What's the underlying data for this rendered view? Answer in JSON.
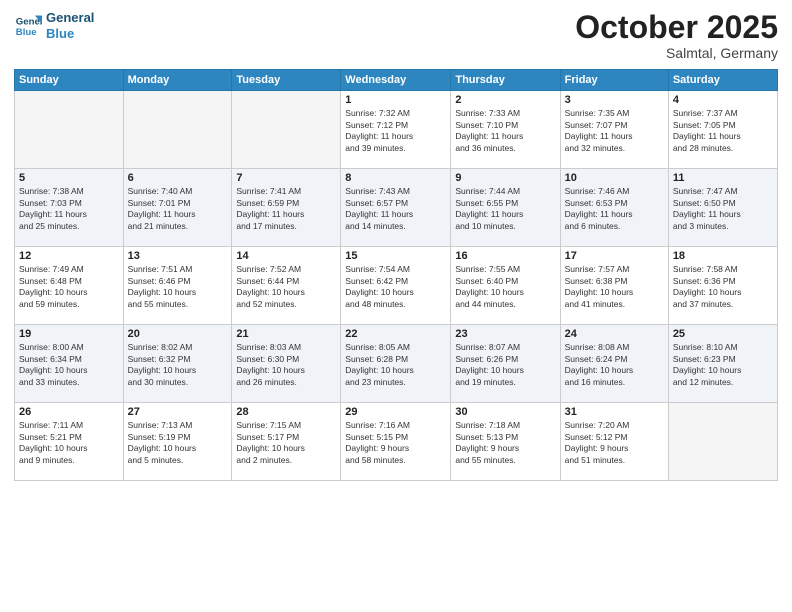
{
  "header": {
    "logo_line1": "General",
    "logo_line2": "Blue",
    "month": "October 2025",
    "location": "Salmtal, Germany"
  },
  "weekdays": [
    "Sunday",
    "Monday",
    "Tuesday",
    "Wednesday",
    "Thursday",
    "Friday",
    "Saturday"
  ],
  "weeks": [
    [
      {
        "day": "",
        "info": ""
      },
      {
        "day": "",
        "info": ""
      },
      {
        "day": "",
        "info": ""
      },
      {
        "day": "1",
        "info": "Sunrise: 7:32 AM\nSunset: 7:12 PM\nDaylight: 11 hours\nand 39 minutes."
      },
      {
        "day": "2",
        "info": "Sunrise: 7:33 AM\nSunset: 7:10 PM\nDaylight: 11 hours\nand 36 minutes."
      },
      {
        "day": "3",
        "info": "Sunrise: 7:35 AM\nSunset: 7:07 PM\nDaylight: 11 hours\nand 32 minutes."
      },
      {
        "day": "4",
        "info": "Sunrise: 7:37 AM\nSunset: 7:05 PM\nDaylight: 11 hours\nand 28 minutes."
      }
    ],
    [
      {
        "day": "5",
        "info": "Sunrise: 7:38 AM\nSunset: 7:03 PM\nDaylight: 11 hours\nand 25 minutes."
      },
      {
        "day": "6",
        "info": "Sunrise: 7:40 AM\nSunset: 7:01 PM\nDaylight: 11 hours\nand 21 minutes."
      },
      {
        "day": "7",
        "info": "Sunrise: 7:41 AM\nSunset: 6:59 PM\nDaylight: 11 hours\nand 17 minutes."
      },
      {
        "day": "8",
        "info": "Sunrise: 7:43 AM\nSunset: 6:57 PM\nDaylight: 11 hours\nand 14 minutes."
      },
      {
        "day": "9",
        "info": "Sunrise: 7:44 AM\nSunset: 6:55 PM\nDaylight: 11 hours\nand 10 minutes."
      },
      {
        "day": "10",
        "info": "Sunrise: 7:46 AM\nSunset: 6:53 PM\nDaylight: 11 hours\nand 6 minutes."
      },
      {
        "day": "11",
        "info": "Sunrise: 7:47 AM\nSunset: 6:50 PM\nDaylight: 11 hours\nand 3 minutes."
      }
    ],
    [
      {
        "day": "12",
        "info": "Sunrise: 7:49 AM\nSunset: 6:48 PM\nDaylight: 10 hours\nand 59 minutes."
      },
      {
        "day": "13",
        "info": "Sunrise: 7:51 AM\nSunset: 6:46 PM\nDaylight: 10 hours\nand 55 minutes."
      },
      {
        "day": "14",
        "info": "Sunrise: 7:52 AM\nSunset: 6:44 PM\nDaylight: 10 hours\nand 52 minutes."
      },
      {
        "day": "15",
        "info": "Sunrise: 7:54 AM\nSunset: 6:42 PM\nDaylight: 10 hours\nand 48 minutes."
      },
      {
        "day": "16",
        "info": "Sunrise: 7:55 AM\nSunset: 6:40 PM\nDaylight: 10 hours\nand 44 minutes."
      },
      {
        "day": "17",
        "info": "Sunrise: 7:57 AM\nSunset: 6:38 PM\nDaylight: 10 hours\nand 41 minutes."
      },
      {
        "day": "18",
        "info": "Sunrise: 7:58 AM\nSunset: 6:36 PM\nDaylight: 10 hours\nand 37 minutes."
      }
    ],
    [
      {
        "day": "19",
        "info": "Sunrise: 8:00 AM\nSunset: 6:34 PM\nDaylight: 10 hours\nand 33 minutes."
      },
      {
        "day": "20",
        "info": "Sunrise: 8:02 AM\nSunset: 6:32 PM\nDaylight: 10 hours\nand 30 minutes."
      },
      {
        "day": "21",
        "info": "Sunrise: 8:03 AM\nSunset: 6:30 PM\nDaylight: 10 hours\nand 26 minutes."
      },
      {
        "day": "22",
        "info": "Sunrise: 8:05 AM\nSunset: 6:28 PM\nDaylight: 10 hours\nand 23 minutes."
      },
      {
        "day": "23",
        "info": "Sunrise: 8:07 AM\nSunset: 6:26 PM\nDaylight: 10 hours\nand 19 minutes."
      },
      {
        "day": "24",
        "info": "Sunrise: 8:08 AM\nSunset: 6:24 PM\nDaylight: 10 hours\nand 16 minutes."
      },
      {
        "day": "25",
        "info": "Sunrise: 8:10 AM\nSunset: 6:23 PM\nDaylight: 10 hours\nand 12 minutes."
      }
    ],
    [
      {
        "day": "26",
        "info": "Sunrise: 7:11 AM\nSunset: 5:21 PM\nDaylight: 10 hours\nand 9 minutes."
      },
      {
        "day": "27",
        "info": "Sunrise: 7:13 AM\nSunset: 5:19 PM\nDaylight: 10 hours\nand 5 minutes."
      },
      {
        "day": "28",
        "info": "Sunrise: 7:15 AM\nSunset: 5:17 PM\nDaylight: 10 hours\nand 2 minutes."
      },
      {
        "day": "29",
        "info": "Sunrise: 7:16 AM\nSunset: 5:15 PM\nDaylight: 9 hours\nand 58 minutes."
      },
      {
        "day": "30",
        "info": "Sunrise: 7:18 AM\nSunset: 5:13 PM\nDaylight: 9 hours\nand 55 minutes."
      },
      {
        "day": "31",
        "info": "Sunrise: 7:20 AM\nSunset: 5:12 PM\nDaylight: 9 hours\nand 51 minutes."
      },
      {
        "day": "",
        "info": ""
      }
    ]
  ]
}
